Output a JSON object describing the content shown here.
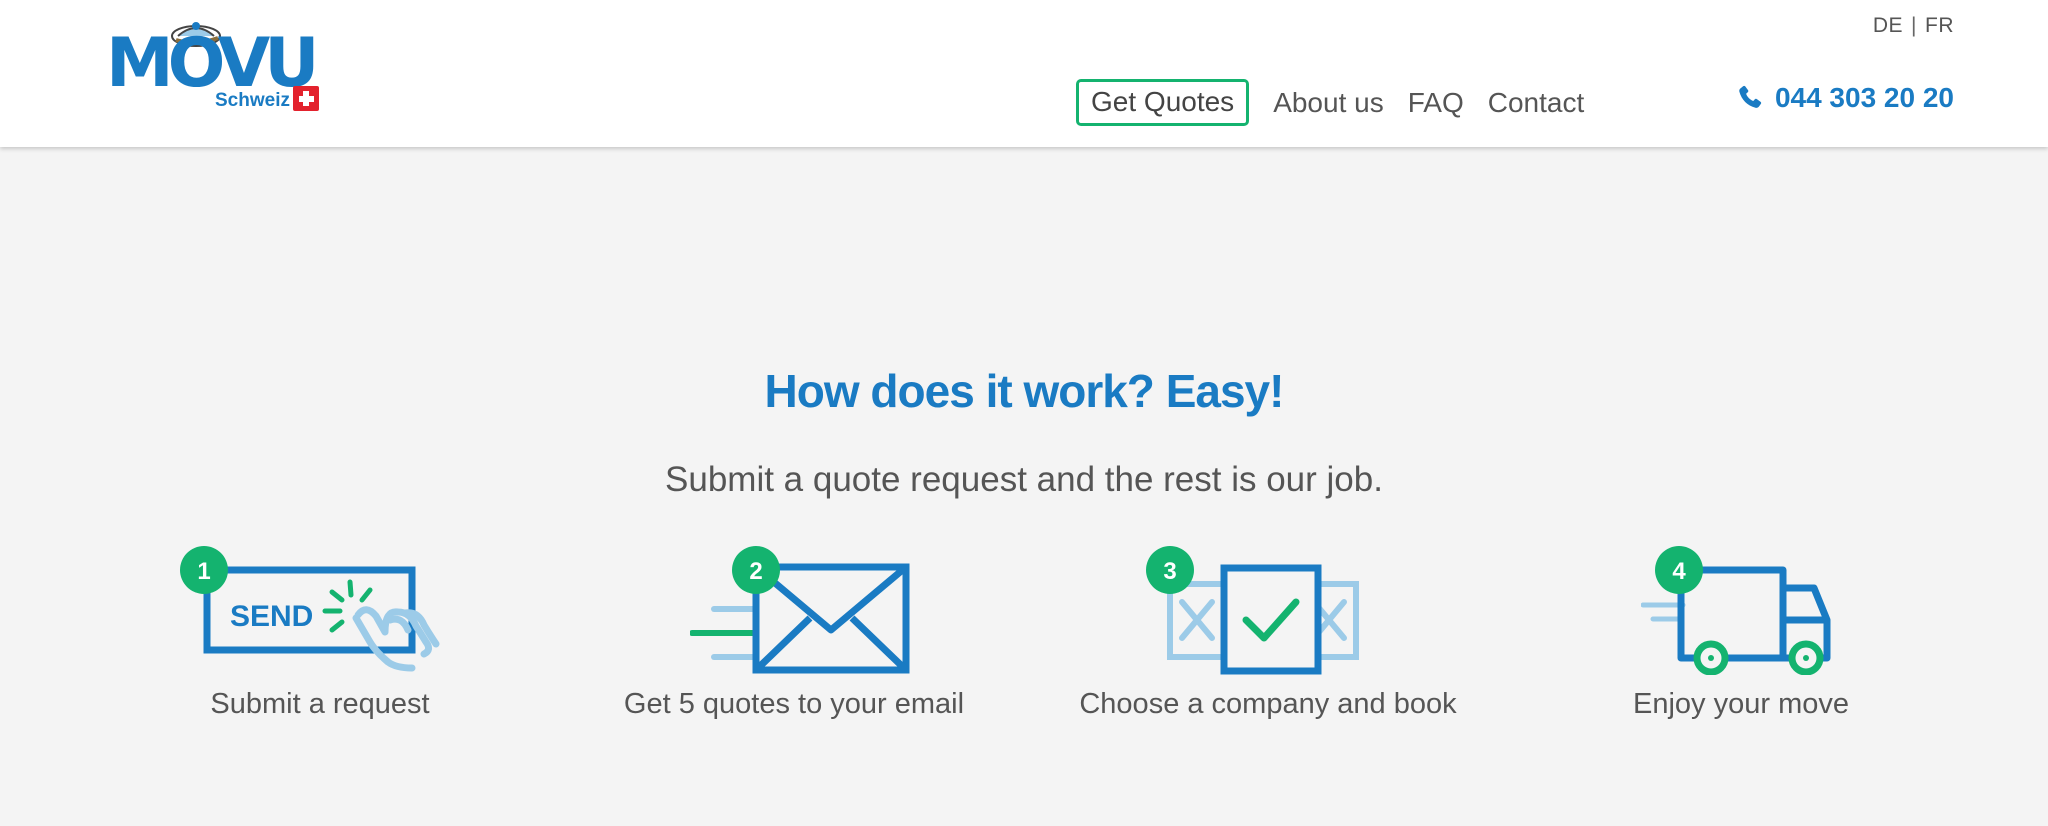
{
  "header": {
    "logo": {
      "word": "MOVU",
      "sub": "Schweiz"
    },
    "languages": [
      "DE",
      "FR"
    ],
    "language_separator": "|",
    "nav": {
      "get_quotes": "Get Quotes",
      "about": "About us",
      "faq": "FAQ",
      "contact": "Contact"
    },
    "phone": {
      "number": "044 303 20 20",
      "icon": "phone-icon"
    }
  },
  "how_it_works": {
    "title": "How does it work? Easy!",
    "subtitle": "Submit a quote request and the rest is our job.",
    "steps": [
      {
        "number": "1",
        "icon": "send-click-icon",
        "button_text": "SEND",
        "label": "Submit a request"
      },
      {
        "number": "2",
        "icon": "envelope-icon",
        "label": "Get 5 quotes to your email"
      },
      {
        "number": "3",
        "icon": "checkbox-choice-icon",
        "label": "Choose a company and book"
      },
      {
        "number": "4",
        "icon": "truck-icon",
        "label": "Enjoy your move"
      }
    ]
  },
  "colors": {
    "brand_blue": "#1a7bc3",
    "light_blue": "#9ccbe8",
    "accent_green": "#14b36f",
    "swiss_red": "#e3222d",
    "background": "#f4f4f4"
  }
}
